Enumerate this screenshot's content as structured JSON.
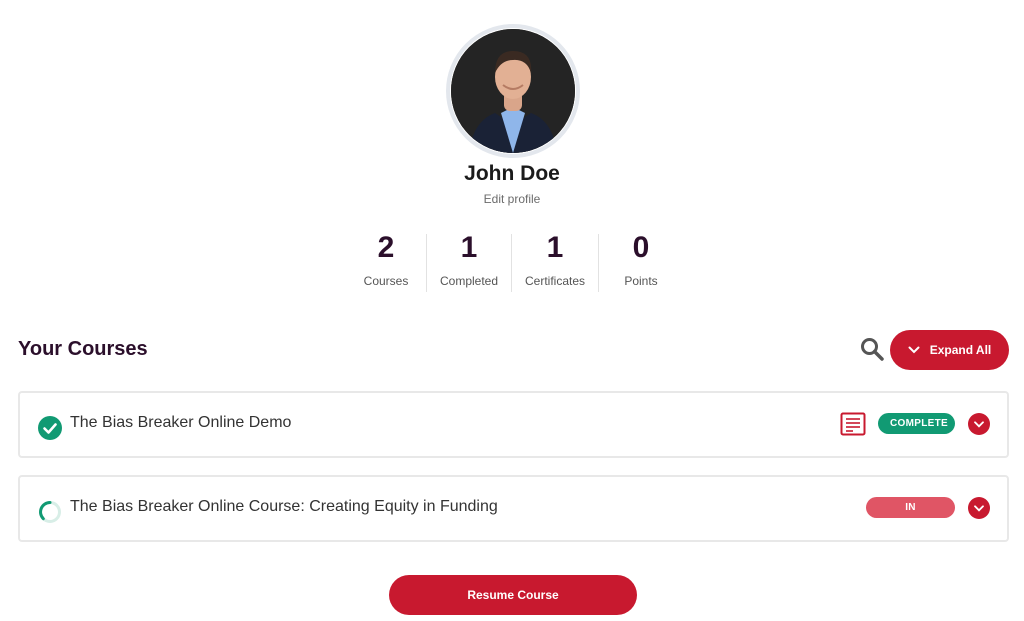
{
  "profile": {
    "name": "John Doe",
    "edit_label": "Edit profile"
  },
  "stats": [
    {
      "value": "2",
      "label": "Courses"
    },
    {
      "value": "1",
      "label": "Completed"
    },
    {
      "value": "1",
      "label": "Certificates"
    },
    {
      "value": "0",
      "label": "Points"
    }
  ],
  "courses_section": {
    "title": "Your Courses",
    "expand_all_label": "Expand All"
  },
  "courses": [
    {
      "title": "The Bias Breaker Online Demo",
      "status": "COMPLETE",
      "status_icon": "check-circle-icon",
      "has_certificate": true
    },
    {
      "title": "The Bias Breaker Online Course: Creating Equity in Funding",
      "status": "IN PROGRESS",
      "status_icon": "progress-ring-icon",
      "has_certificate": false
    }
  ],
  "resume_label": "Resume Course",
  "colors": {
    "accent": "#c8192f",
    "complete": "#119a73",
    "in_progress": "#e05565",
    "heading": "#2b0f2b"
  }
}
